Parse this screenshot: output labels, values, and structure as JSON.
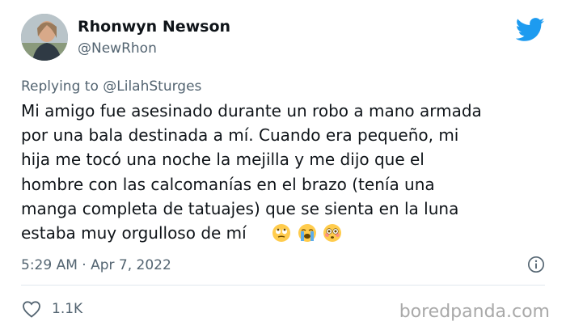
{
  "tweet": {
    "author_name": "Rhonwyn Newson",
    "author_handle": "@NewRhon",
    "replying_to_prefix": "Replying to",
    "replying_to_handle": "@LilahSturges",
    "text_lines": [
      "Mi amigo fue asesinado durante un robo a mano armada",
      "por una bala destinada a mí. Cuando era pequeño, mi",
      "hija me tocó una noche la mejilla y me dijo que el",
      "hombre con las calcomanías en el brazo (tenía una",
      "manga completa de tatuajes) que se sienta en la luna",
      "estaba muy orgulloso de mí"
    ],
    "emojis": [
      "rolling-eyes-emoji",
      "loudly-crying-emoji",
      "flushed-emoji"
    ],
    "timestamp": "5:29 AM · Apr 7, 2022",
    "likes": "1.1K"
  },
  "watermark": "boredpanda.com",
  "colors": {
    "twitter_blue": "#1d9bf0",
    "secondary_text": "#536471",
    "divider": "#e1e8ed"
  }
}
